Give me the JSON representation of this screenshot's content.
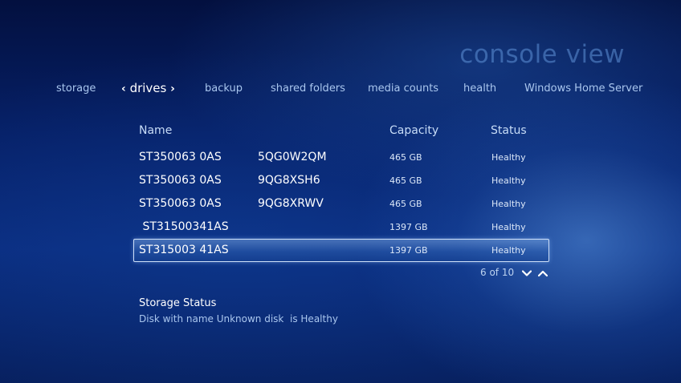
{
  "header": {
    "title": "console view"
  },
  "tabs": [
    {
      "label": "storage"
    },
    {
      "label": "drives",
      "active": true,
      "left_chevron": "‹",
      "right_chevron": "›"
    },
    {
      "label": "backup"
    },
    {
      "label": "shared folders"
    },
    {
      "label": "media counts"
    },
    {
      "label": "health"
    },
    {
      "label": "Windows Home Server"
    }
  ],
  "table": {
    "headers": {
      "name": "Name",
      "capacity": "Capacity",
      "status": "Status"
    },
    "rows": [
      {
        "name": "ST350063 0AS",
        "serial": "5QG0W2QM",
        "capacity": "465 GB",
        "status": "Healthy",
        "selected": false
      },
      {
        "name": "ST350063 0AS",
        "serial": "9QG8XSH6",
        "capacity": "465 GB",
        "status": "Healthy",
        "selected": false
      },
      {
        "name": "ST350063 0AS",
        "serial": "9QG8XRWV",
        "capacity": "465 GB",
        "status": "Healthy",
        "selected": false
      },
      {
        "name": " ST31500341AS",
        "serial": "",
        "capacity": "1397 GB",
        "status": "Healthy",
        "selected": false
      },
      {
        "name": "ST315003 41AS",
        "serial": "",
        "capacity": "1397 GB",
        "status": "Healthy",
        "selected": true
      }
    ]
  },
  "pager": {
    "text": "6 of 10",
    "down_icon": "chevron-down-icon",
    "up_icon": "chevron-up-icon"
  },
  "storage_status": {
    "title": "Storage Status",
    "text": "Disk with name Unknown disk  is Healthy"
  },
  "colors": {
    "background": "#0a2d80",
    "selection_border": "#cfe0f8",
    "inactive_tab": "#a9c6ee",
    "title": "#5f91d7"
  }
}
